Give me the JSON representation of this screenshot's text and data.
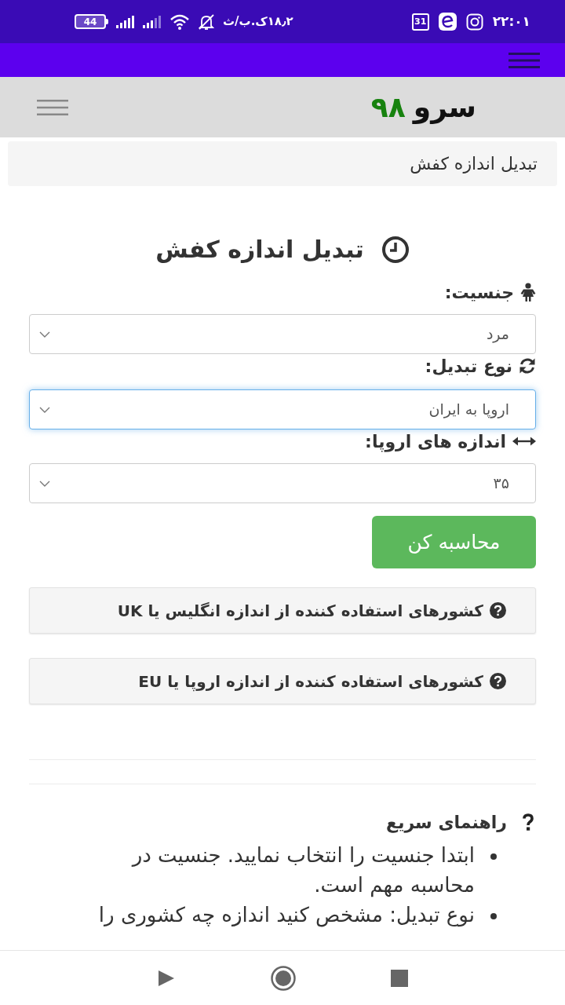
{
  "status_bar": {
    "battery": "44",
    "network_speed": "۱۸٫۲ک.ب/ث",
    "calendar_day": "31",
    "time": "۲۲:۰۱"
  },
  "header": {
    "logo_name": "سرو",
    "logo_number": "۹۸"
  },
  "breadcrumb": "تبدیل اندازه کفش",
  "converter": {
    "title": "تبدیل اندازه کفش",
    "gender": {
      "label": "جنسیت:",
      "value": "مرد",
      "focused": false
    },
    "conversion_type": {
      "label": "نوع تبدیل:",
      "value": "اروپا به ایران",
      "focused": true
    },
    "size": {
      "label": "اندازه های اروپا:",
      "value": "۳۵",
      "focused": false
    },
    "submit_button": "محاسبه کن"
  },
  "accordion": [
    {
      "title": "کشورهای استفاده کننده از اندازه انگلیس یا UK"
    },
    {
      "title": "کشورهای استفاده کننده از اندازه اروپا یا EU"
    }
  ],
  "help": {
    "title": "راهنمای سریع",
    "items": [
      "ابتدا جنسیت را انتخاب نمایید. جنسیت در محاسبه مهم است.",
      "نوع تبدیل: مشخص کنید اندازه چه کشوری را"
    ]
  }
}
